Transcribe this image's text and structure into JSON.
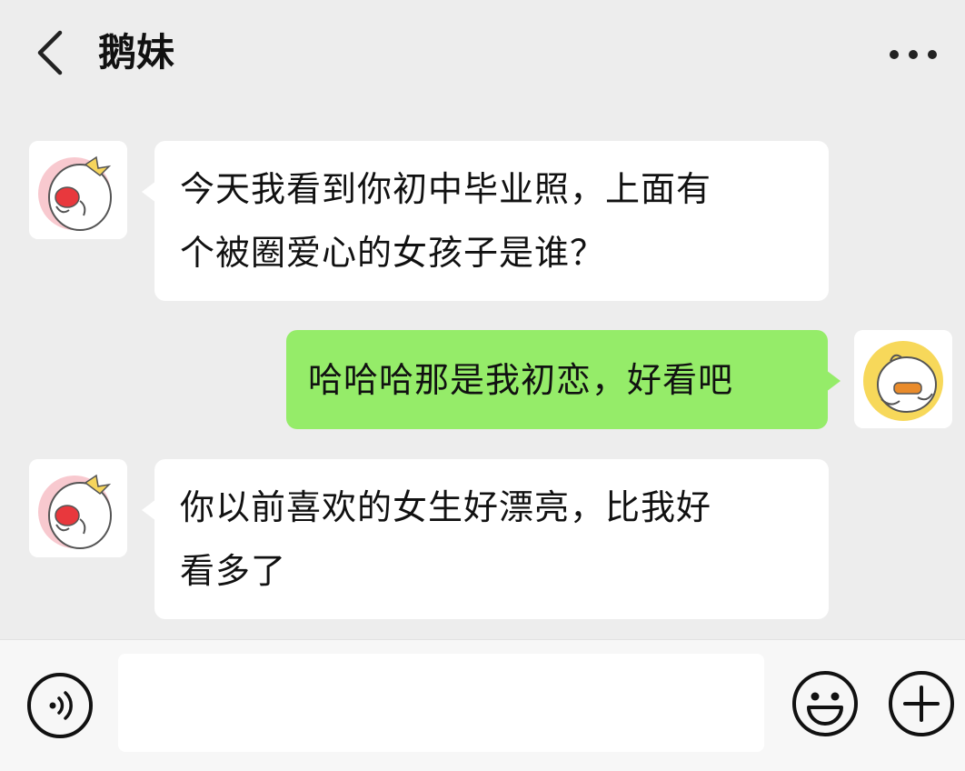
{
  "header": {
    "title": "鹅妹",
    "back_icon": "chevron-left-icon",
    "more_icon": "more-dots-icon"
  },
  "messages": [
    {
      "sender": "contact",
      "lines": [
        "今天我看到你初中毕业照，上面有",
        "个被圈爱心的女孩子是谁？"
      ]
    },
    {
      "sender": "me",
      "lines": [
        "哈哈哈那是我初恋，好看吧"
      ]
    },
    {
      "sender": "contact",
      "lines": [
        "你以前喜欢的女生好漂亮，比我好",
        "看多了"
      ]
    }
  ],
  "input_bar": {
    "voice_icon": "voice-icon",
    "text_value": "",
    "emoji_icon": "emoji-icon",
    "plus_icon": "plus-icon"
  },
  "colors": {
    "background": "#ededed",
    "incoming_bubble": "#ffffff",
    "outgoing_bubble": "#95ec69",
    "text": "#111111"
  }
}
